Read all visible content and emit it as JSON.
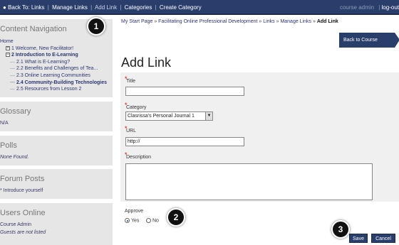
{
  "topbar": {
    "back_to": "Back To: Links",
    "manage_links": "Manage Links",
    "add_link": "Add Link",
    "categories": "Categories",
    "create_category": "Create Category",
    "separator": "|",
    "user": "course admin",
    "sep2": "|",
    "logout": "log-out"
  },
  "sidebar": {
    "nav_title": "Content Navigation",
    "home": "Home",
    "tree": {
      "item1": "1 Welcome, New Facilitator!",
      "item2": "2 Introduction to E-Learning",
      "sub1": "2.1 What is E-Learning?",
      "sub2": "2.2 Benefits and Challenges of Tea...",
      "sub3": "2.3 Online Learning Communities",
      "sub4": "2.4 Community-Building Technologies",
      "sub5": "2.5 Resources from Lesson 2"
    },
    "glossary_title": "Glossary",
    "glossary_text": "N/A",
    "polls_title": "Polls",
    "polls_text": "None Found.",
    "forum_title": "Forum Posts",
    "forum_text": "* Introduce yourself",
    "users_title": "Users Online",
    "users_line1": "Course Admin",
    "users_line2": "Guests are not listed"
  },
  "main": {
    "breadcrumb": {
      "start": "My Start Page",
      "sep": "»",
      "course": "Facilitating Online Professional Development",
      "links": "Links",
      "manage": "Manage Links",
      "current": "Add Link"
    },
    "back_button": "Back to Course",
    "title": "Add Link",
    "form": {
      "required_mark": "*",
      "title_label": "Title",
      "title_value": "",
      "category_label": "Category",
      "category_value": "Clasrissa's Personal Journal 1",
      "url_label": "URL",
      "url_value": "http://",
      "description_label": "Description",
      "description_value": "",
      "approve_label": "Approve",
      "yes_label": "Yes",
      "no_label": "No",
      "approve_selected": "Yes",
      "save_label": "Save",
      "cancel_label": "Cancel"
    }
  },
  "callouts": {
    "one": "1",
    "two": "2",
    "three": "3"
  },
  "colors": {
    "topbar": "#2a3e6c",
    "sidebar_bg": "#e6e6e6",
    "form_bg": "#f0f0f0",
    "required": "#cc0000"
  }
}
